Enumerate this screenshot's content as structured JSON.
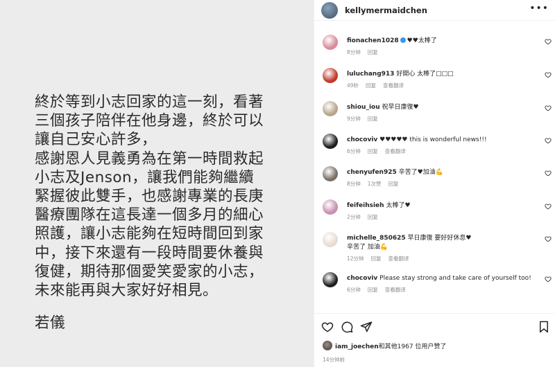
{
  "post": {
    "lines": [
      "終於等到小志回家的這一刻，看著",
      "三個孩子陪伴在他身邊，終於可以",
      "讓自己安心許多，",
      "感謝恩人見義勇為在第一時間救起",
      "小志及Jenson，讓我們能夠繼續",
      "緊握彼此雙手，也感謝專業的長庚",
      "醫療團隊在這長達一個多月的細心",
      "照護，讓小志能夠在短時間回到家",
      "中，接下來還有一段時間要休養與",
      "復健，期待那個愛笑愛家的小志，",
      "未來能再與大家好好相見。"
    ],
    "signature": "若儀"
  },
  "header": {
    "username": "kellymermaidchen",
    "more_icon": "ellipsis-icon"
  },
  "comments": [
    {
      "user": "fionachen1028",
      "verified": true,
      "text": "♥♥太棒了",
      "meta": [
        "8分钟",
        "回复"
      ],
      "avatar_color": "#d98a9a"
    },
    {
      "user": "luluchang913",
      "verified": false,
      "text": "好開心 太棒了□□□",
      "meta": [
        "49秒",
        "回复",
        "查看翻译"
      ],
      "avatar_color": "#c0392b"
    },
    {
      "user": "shiou_iou",
      "verified": false,
      "text": "祝早日康復♥",
      "meta": [
        "9分钟",
        "回复"
      ],
      "avatar_color": "#b8a58a"
    },
    {
      "user": "chocoviv",
      "verified": false,
      "text": "♥♥♥♥♥ this is wonderful news!!!",
      "meta": [
        "6分钟",
        "回复",
        "查看翻译"
      ],
      "avatar_color": "#1e1e1e"
    },
    {
      "user": "chenyufen925",
      "verified": false,
      "text": "辛苦了♥加油💪",
      "meta": [
        "8分钟",
        "1次赞",
        "回复"
      ],
      "avatar_color": "#7a6f65"
    },
    {
      "user": "feifeihsieh",
      "verified": false,
      "text": "太棒了♥",
      "meta": [
        "2分钟",
        "回复"
      ],
      "avatar_color": "#c98fb0"
    },
    {
      "user": "michelle_850625",
      "verified": false,
      "text": "早日康復 要好好休息♥",
      "text2": "辛苦了 加油💪",
      "meta": [
        "12分钟",
        "回复",
        "查看翻译"
      ],
      "avatar_color": "#e7dcd3"
    },
    {
      "user": "chocoviv",
      "verified": false,
      "text": "Please stay strong and take care of yourself too!",
      "meta": [
        "6分钟",
        "回复",
        "查看翻译"
      ],
      "avatar_color": "#1e1e1e"
    }
  ],
  "actions": {
    "like_icon": "heart-icon",
    "comment_icon": "comment-icon",
    "share_icon": "send-icon",
    "save_icon": "bookmark-icon"
  },
  "likes": {
    "user": "iam_joechen",
    "text": "和其他1967 位用户赞了"
  },
  "timestamp": "14分钟前"
}
